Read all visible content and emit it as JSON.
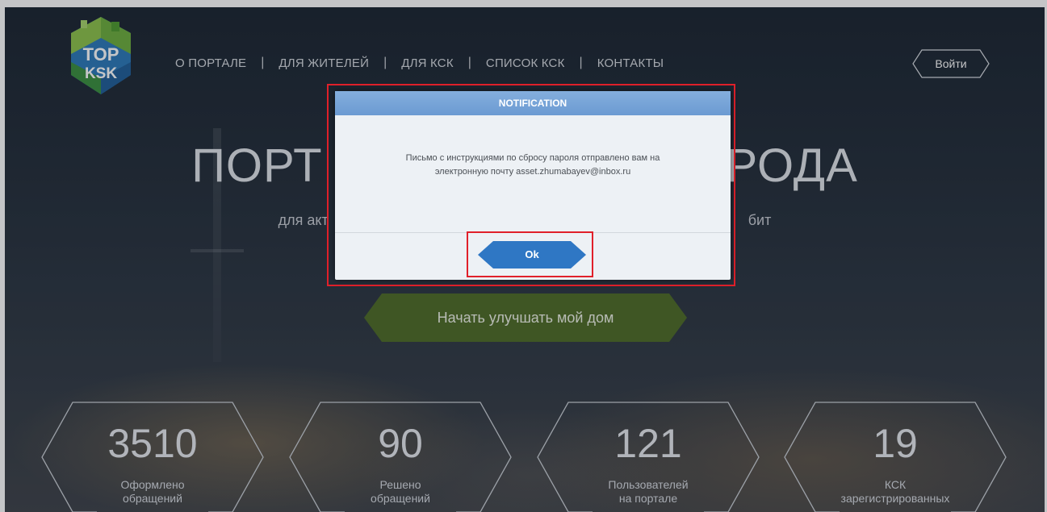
{
  "logo": {
    "line1": "TOP",
    "line2": "KSK"
  },
  "nav": {
    "items": [
      "О ПОРТАЛЕ",
      "ДЛЯ ЖИТЕЛЕЙ",
      "ДЛЯ КСК",
      "СПИСОК КСК",
      "КОНТАКТЫ"
    ],
    "separator": "|",
    "login_label": "Войти"
  },
  "hero": {
    "title_left": "ПОРТ",
    "title_right": "РОДА",
    "subtitle_left": "для акт",
    "subtitle_right": "бит",
    "cta_label": "Начать улучшать мой дом"
  },
  "stats": [
    {
      "value": "3510",
      "label_line1": "Оформлено",
      "label_line2": "обращений"
    },
    {
      "value": "90",
      "label_line1": "Решено",
      "label_line2": "обращений"
    },
    {
      "value": "121",
      "label_line1": "Пользователей",
      "label_line2": "на портале"
    },
    {
      "value": "19",
      "label_line1": "КСК",
      "label_line2": "зарегистрированных"
    }
  ],
  "modal": {
    "title": "NOTIFICATION",
    "message_line1": "Письмо с инструкциями по сбросу пароля отправлено вам на",
    "message_line2": "электронную почту asset.zhumabayev@inbox.ru",
    "ok_label": "Ok"
  },
  "colors": {
    "brand_green": "#5a7a2a",
    "modal_header": "#6b9ad2",
    "ok_button": "#2f77c4",
    "highlight": "#e0202a"
  }
}
